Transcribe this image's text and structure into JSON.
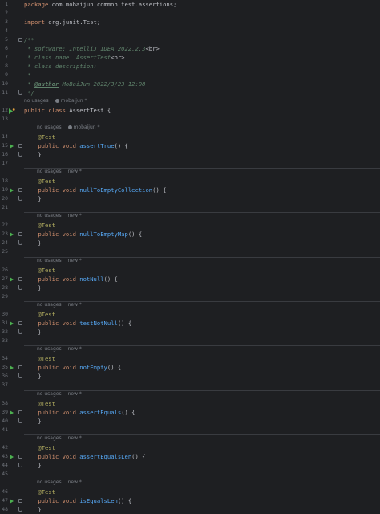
{
  "file": {
    "package_keyword": "package",
    "package_name": "com.mobaijun.common.test.assertions",
    "import_keyword": "import",
    "import_name": "org.junit.Test",
    "javadoc_open": "/**",
    "doc_software": "* software: IntelliJ IDEA 2022.2.3",
    "doc_br": "<br>",
    "doc_class_name": "* class name: AssertTest",
    "doc_class_desc": "* class description:",
    "doc_star": "*",
    "doc_author_tag": "@author",
    "doc_author_value": " MoBaiJun 2022/3/23 12:08",
    "javadoc_close": "*/",
    "class_hint_usages": "no usages",
    "class_hint_author": "mobaijun *",
    "class_public": "public",
    "class_kw": "class",
    "class_name": "AssertTest",
    "open_brace": "{",
    "close_brace": "}",
    "semicolon": ";",
    "annotation": "@Test",
    "public_kw": "public",
    "void_kw": "void",
    "parens_open": "() {",
    "no_usages": "no usages",
    "new_mark": "new *",
    "author_mark": "mobaijun *"
  },
  "line_numbers": [
    "1",
    "2",
    "3",
    "4",
    "5",
    "6",
    "7",
    "8",
    "9",
    "10",
    "11",
    "12",
    "13",
    "14",
    "15",
    "16",
    "17",
    "18",
    "19",
    "20",
    "21",
    "22",
    "23",
    "24",
    "25",
    "26",
    "27",
    "28",
    "29",
    "30",
    "31",
    "32",
    "33",
    "34",
    "35",
    "36",
    "37",
    "38",
    "39",
    "40",
    "41",
    "42",
    "43",
    "44",
    "45",
    "46",
    "47",
    "48"
  ],
  "methods": [
    {
      "name": "assertTrue",
      "author": "mobaijun *"
    },
    {
      "name": "nullToEmptyCollection",
      "author": "new *"
    },
    {
      "name": "nullToEmptyMap",
      "author": "new *"
    },
    {
      "name": "notNull",
      "author": "new *"
    },
    {
      "name": "testNotNull",
      "author": "new *"
    },
    {
      "name": "notEmpty",
      "author": "new *"
    },
    {
      "name": "assertEquals",
      "author": "new *"
    },
    {
      "name": "assertEqualsLen",
      "author": "new *"
    },
    {
      "name": "isEqualsLen",
      "author": "new *"
    }
  ],
  "colors": {
    "background": "#1e1f22",
    "keyword": "#cf8e6d",
    "annotation": "#b3ae60",
    "method": "#56a8f5",
    "comment": "#5f826b",
    "run_icon": "#4caf50"
  }
}
